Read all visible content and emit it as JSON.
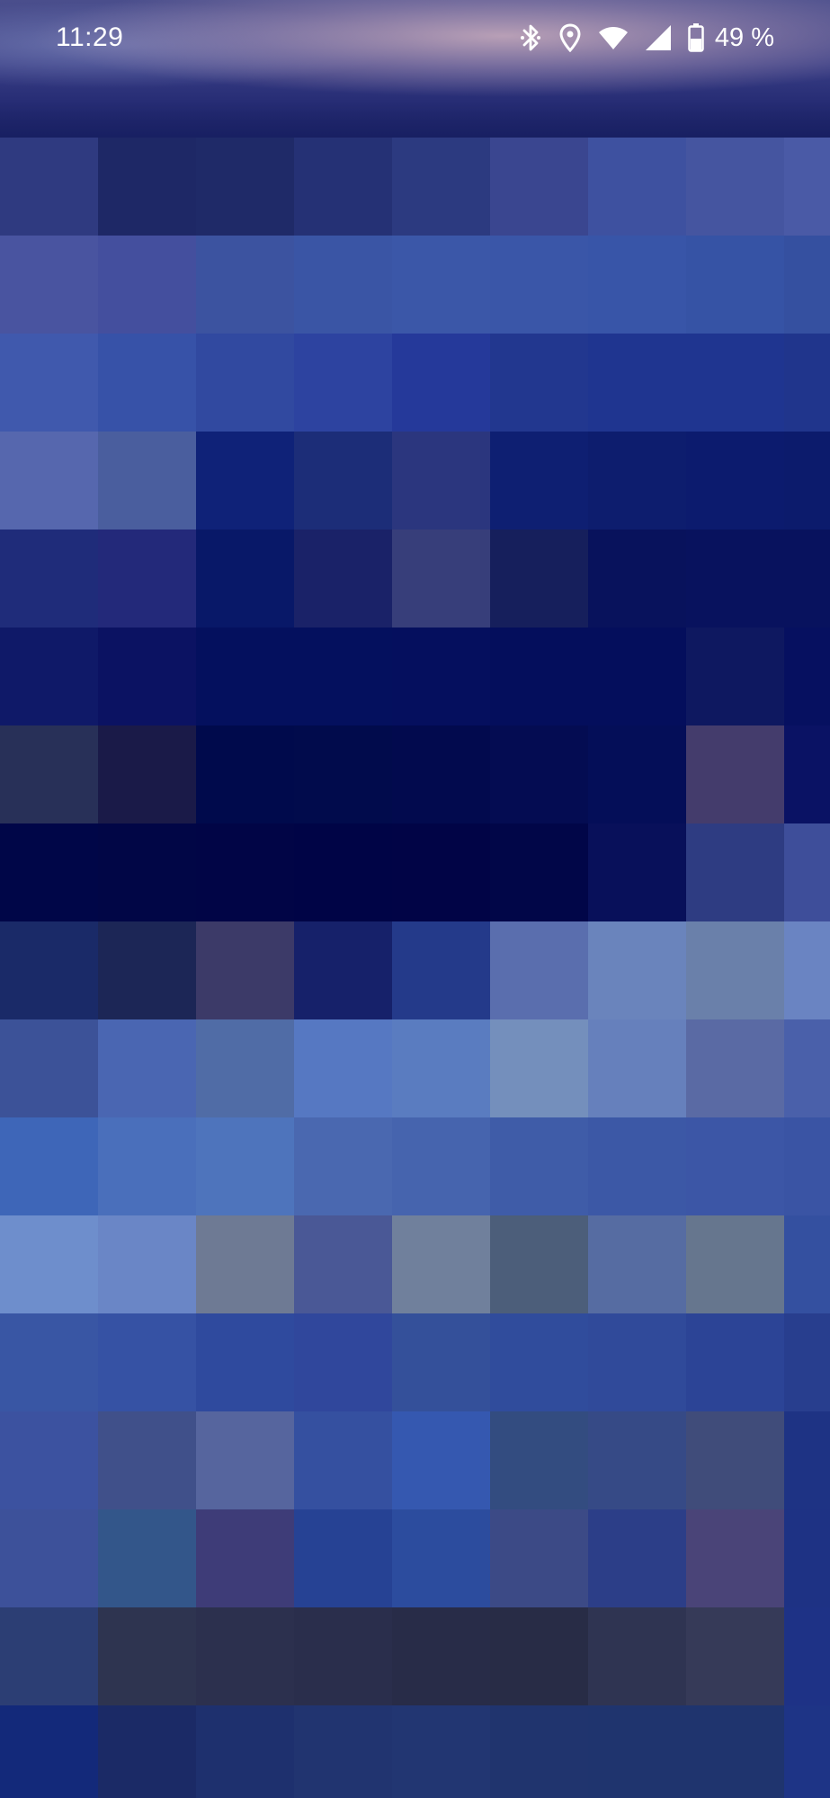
{
  "status_bar": {
    "time": "11:29",
    "battery_percent": "49 %",
    "icons": [
      "bluetooth-icon",
      "location-icon",
      "wifi-icon",
      "cell-signal-icon",
      "battery-icon"
    ]
  },
  "pixelated_image": {
    "columns": 9,
    "rows": 17,
    "colors": [
      [
        "#2f3a80",
        "#1e2866",
        "#1f2a68",
        "#253175",
        "#2c3a80",
        "#3a4690",
        "#3e51a0",
        "#4555a0",
        "#4a5aa6"
      ],
      [
        "#4954a0",
        "#444f9e",
        "#3c53a0",
        "#3a55a5",
        "#3b57a8",
        "#3a56a8",
        "#3855a8",
        "#3653a5",
        "#3550a0"
      ],
      [
        "#4059ad",
        "#3752a8",
        "#3149a0",
        "#2d43a0",
        "#25399a",
        "#22378f",
        "#1f3590",
        "#1f3590",
        "#20358c"
      ],
      [
        "#5667ae",
        "#4a5e9e",
        "#0f2278",
        "#1c2d78",
        "#2b367e",
        "#0e1f72",
        "#0d1d6e",
        "#0c1b6e",
        "#0c1b6c"
      ],
      [
        "#1f2c7a",
        "#23297a",
        "#081868",
        "#1a2268",
        "#373e7a",
        "#161f5c",
        "#08125c",
        "#08125e",
        "#08125e"
      ],
      [
        "#0f1968",
        "#0b1262",
        "#04105e",
        "#04105e",
        "#050f5e",
        "#040e5c",
        "#040e5c",
        "#0e1860",
        "#061060"
      ],
      [
        "#283058",
        "#1a1a48",
        "#000a4c",
        "#010b4c",
        "#020a4e",
        "#040c52",
        "#040e58",
        "#443c6c",
        "#0a1264"
      ],
      [
        "#000648",
        "#010646",
        "#010546",
        "#000446",
        "#010446",
        "#010648",
        "#08105a",
        "#2e3c82",
        "#3e4e9a"
      ],
      [
        "#1a2a68",
        "#1c2656",
        "#3c3a68",
        "#16216a",
        "#243a8a",
        "#5a6eae",
        "#6a84bc",
        "#6a80aa",
        "#6a84c2"
      ],
      [
        "#3c5298",
        "#4a66b2",
        "#506ca6",
        "#5678c2",
        "#5a7cc0",
        "#748fbc",
        "#6680bc",
        "#5a6aa4",
        "#4a60aa"
      ],
      [
        "#3e66b8",
        "#4a6fbb",
        "#4e74bc",
        "#4a68b0",
        "#4664ae",
        "#3f5ca8",
        "#3c58a6",
        "#3c56a6",
        "#3a54a4"
      ],
      [
        "#6e8ecc",
        "#6a86c6",
        "#6e7a94",
        "#4a5896",
        "#70809c",
        "#4c5e7a",
        "#566ca2",
        "#66768e",
        "#3450a0"
      ],
      [
        "#3956a4",
        "#3652a4",
        "#2f4a9e",
        "#30479c",
        "#34509a",
        "#304c9c",
        "#304a9a",
        "#2c4496",
        "#283e8e"
      ],
      [
        "#3c52a0",
        "#40508a",
        "#56659e",
        "#3550a0",
        "#3558b0",
        "#334c80",
        "#364a86",
        "#404c7a",
        "#1e3384"
      ],
      [
        "#3d519a",
        "#33568a",
        "#3e3c78",
        "#264294",
        "#2c4c9e",
        "#3c4a86",
        "#2c3e88",
        "#4a4478",
        "#1e3284"
      ],
      [
        "#2c3e74",
        "#2e3450",
        "#2c304e",
        "#2a2e4c",
        "#282c48",
        "#282c46",
        "#2f3452",
        "#363a58",
        "#1e3286"
      ],
      [
        "#13297a",
        "#1b2a66",
        "#1e306e",
        "#213470",
        "#223672",
        "#20346e",
        "#1f346e",
        "#1f346e",
        "#1e3486"
      ]
    ]
  }
}
